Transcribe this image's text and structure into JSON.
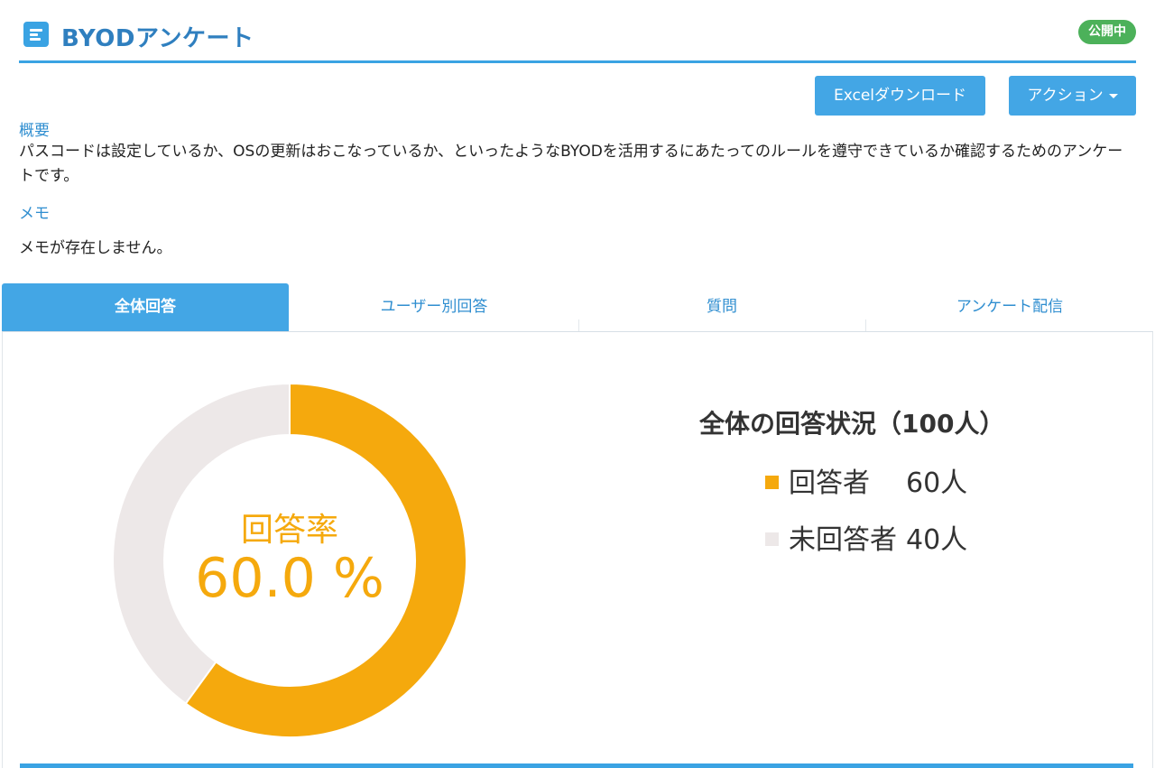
{
  "header": {
    "title": "BYODアンケート",
    "status": "公開中",
    "title_icon": "survey-icon"
  },
  "toolbar": {
    "excel_label": "Excelダウンロード",
    "action_label": "アクション"
  },
  "overview": {
    "label": "概要",
    "text": "パスコードは設定しているか、OSの更新はおこなっているか、といったようなBYODを活用するにあたってのルールを遵守できているか確認するためのアンケートです。"
  },
  "memo": {
    "label": "メモ",
    "text": "メモが存在しません。"
  },
  "tabs": [
    {
      "label": "全体回答",
      "active": true
    },
    {
      "label": "ユーザー別回答",
      "active": false
    },
    {
      "label": "質問",
      "active": false
    },
    {
      "label": "アンケート配信",
      "active": false
    }
  ],
  "colors": {
    "accent": "#43a6e5",
    "answered": "#f5a90d",
    "unanswered": "#ede8e8",
    "status": "#4cb15a"
  },
  "summary": {
    "center_label": "回答率",
    "center_value": "60.0 %",
    "title": "全体の回答状況（100人）",
    "answered_label": "回答者",
    "answered_count": "60人",
    "unanswered_label": "未回答者",
    "unanswered_count": "40人"
  },
  "chart_data": {
    "type": "pie",
    "categories": [
      "回答者",
      "未回答者"
    ],
    "values": [
      60,
      40
    ],
    "colors": [
      "#f5a90d",
      "#ede8e8"
    ],
    "center_text": "回答率 60.0 %",
    "title": "全体の回答状況（100人）"
  }
}
